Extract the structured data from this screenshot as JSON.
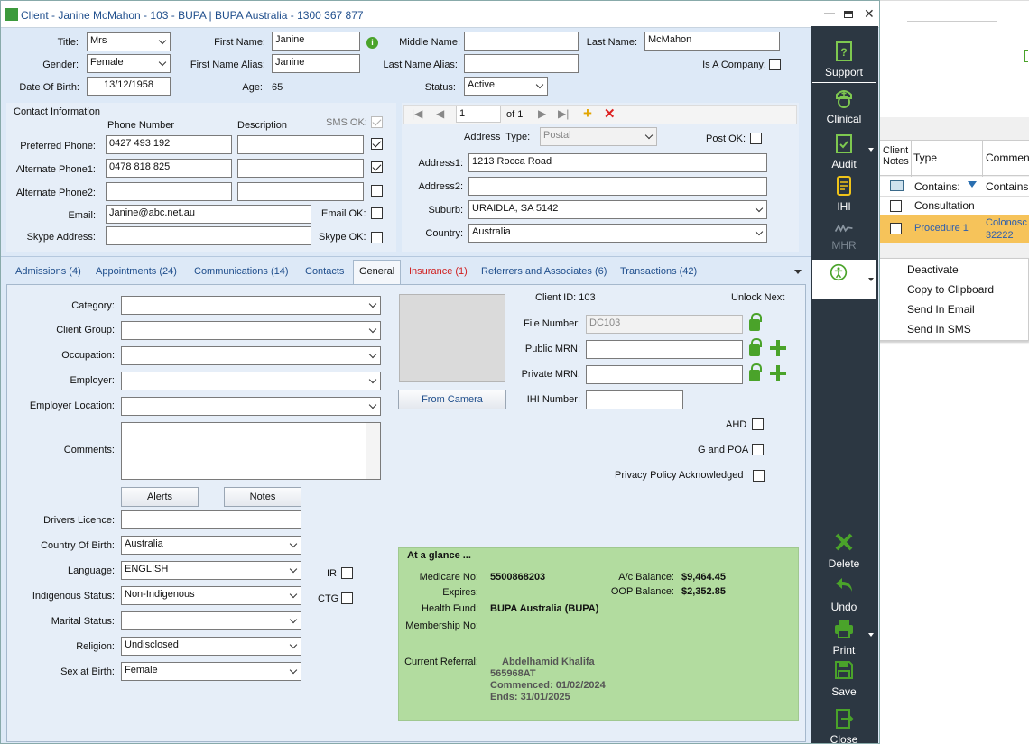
{
  "window": {
    "title": "Client - Janine McMahon - 103 - BUPA | BUPA Australia - 1300 367 877"
  },
  "client": {
    "title_label": "Title:",
    "title": "Mrs",
    "first_name_label": "First Name:",
    "first_name": "Janine",
    "middle_name_label": "Middle Name:",
    "middle_name": "",
    "last_name_label": "Last Name:",
    "last_name": "McMahon",
    "gender_label": "Gender:",
    "gender": "Female",
    "first_alias_label": "First Name Alias:",
    "first_alias": "Janine",
    "last_alias_label": "Last Name Alias:",
    "last_alias": "",
    "company_label": "Is A Company:",
    "dob_label": "Date Of Birth:",
    "dob": "13/12/1958",
    "age_label": "Age:",
    "age": "65",
    "status_label": "Status:",
    "status": "Active"
  },
  "contact": {
    "heading": "Contact Information",
    "phone_col": "Phone Number",
    "desc_col": "Description",
    "sms_col": "SMS OK:",
    "preferred_label": "Preferred Phone:",
    "preferred": "0427 493 192",
    "alt1_label": "Alternate Phone1:",
    "alt1": "0478 818 825",
    "alt2_label": "Alternate Phone2:",
    "alt2": "",
    "email_label": "Email:",
    "email": "Janine@abc.net.au",
    "email_ok_label": "Email OK:",
    "skype_label": "Skype Address:",
    "skype": "",
    "skype_ok_label": "Skype OK:"
  },
  "address": {
    "record": "1",
    "of": "of 1",
    "type_label": "Address  Type:",
    "type": "Postal",
    "post_ok_label": "Post OK:",
    "addr1_label": "Address1:",
    "addr1": "1213 Rocca Road",
    "addr2_label": "Address2:",
    "addr2": "",
    "suburb_label": "Suburb:",
    "suburb": "URAIDLA, SA 5142",
    "country_label": "Country:",
    "country": "Australia"
  },
  "tabs": [
    "Admissions (4)",
    "Appointments (24)",
    "Communications (14)",
    "Contacts",
    "General",
    "Insurance (1)",
    "Referrers and Associates (6)",
    "Transactions (42)"
  ],
  "general": {
    "category_label": "Category:",
    "category": "",
    "group_label": "Client Group:",
    "group": "",
    "occupation_label": "Occupation:",
    "occupation": "",
    "employer_label": "Employer:",
    "employer": "",
    "employer_loc_label": "Employer Location:",
    "employer_loc": "",
    "comments_label": "Comments:",
    "comments": "",
    "alerts_btn": "Alerts",
    "notes_btn": "Notes",
    "licence_label": "Drivers Licence:",
    "licence": "",
    "cob_label": "Country Of Birth:",
    "cob": "Australia",
    "language_label": "Language:",
    "language": "ENGLISH",
    "indigenous_label": "Indigenous Status:",
    "indigenous": "Non-Indigenous",
    "marital_label": "Marital Status:",
    "marital": "",
    "religion_label": "Religion:",
    "religion": "Undisclosed",
    "sex_label": "Sex at Birth:",
    "sex": "Female",
    "ir_label": "IR",
    "ctg_label": "CTG",
    "camera_btn": "From Camera",
    "client_id": "Client ID: 103",
    "unlock_next": "Unlock Next",
    "file_label": "File Number:",
    "file": "DC103",
    "public_label": "Public MRN:",
    "public": "",
    "private_label": "Private MRN:",
    "private": "",
    "ihi_label": "IHI Number:",
    "ihi": "",
    "ahd_label": "AHD",
    "gpoa_label": "G and POA",
    "privacy_label": "Privacy Policy Acknowledged"
  },
  "glance": {
    "heading": "At a glance ...",
    "medicare_label": "Medicare No:",
    "medicare": "5500868203",
    "expires_label": "Expires:",
    "ac_label": "A/c Balance:",
    "ac": "$9,464.45",
    "oop_label": "OOP Balance:",
    "oop": "$2,352.85",
    "fund_label": "Health Fund:",
    "fund": "BUPA Australia (BUPA)",
    "membership_label": "Membership No:",
    "referral_label": "Current Referral:",
    "ref_name": "Abdelhamid Khalifa",
    "ref_num": "565968AT",
    "ref_commenced": "Commenced: 01/02/2024",
    "ref_ends": "Ends: 31/01/2025"
  },
  "sidebar": {
    "support": "Support",
    "clinical": "Clinical",
    "audit": "Audit",
    "ihi": "IHI",
    "mhr": "MHR",
    "delete": "Delete",
    "undo": "Undo",
    "print": "Print",
    "save": "Save",
    "close": "Close"
  },
  "menu": [
    "Deactivate",
    "Copy to Clipboard",
    "Send In Email",
    "Send In SMS"
  ],
  "bg_grid": {
    "col_notes": "Client Notes",
    "col_type": "Type",
    "col_comments": "Comment",
    "filter1": "Contains:",
    "filter2": "Contains:",
    "row1": "Consultation",
    "row2": "Procedure 1",
    "row2_comment1": "Colonosc",
    "row2_comment2": "32222"
  }
}
